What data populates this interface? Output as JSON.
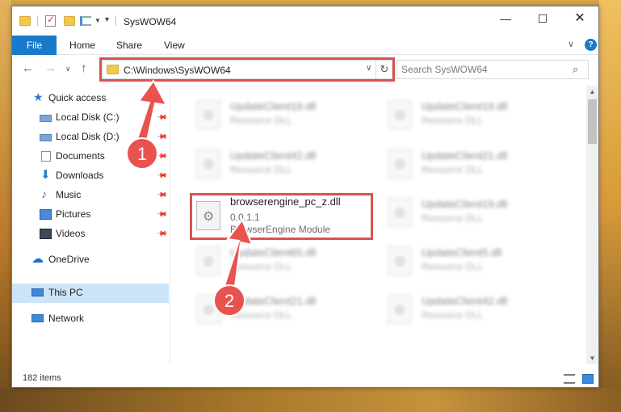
{
  "window": {
    "title": "SysWOW64"
  },
  "ribbon": {
    "tabs": [
      "File",
      "Home",
      "Share",
      "View"
    ]
  },
  "navigation": {
    "address": "C:\\Windows\\SysWOW64",
    "search_placeholder": "Search SysWOW64"
  },
  "sidebar": {
    "items": [
      {
        "label": "Quick access",
        "icon": "star-icon",
        "pinned": false
      },
      {
        "label": "Local Disk (C:)",
        "icon": "drive-icon",
        "pinned": true
      },
      {
        "label": "Local Disk (D:)",
        "icon": "drive-icon",
        "pinned": true
      },
      {
        "label": "Documents",
        "icon": "documents-icon",
        "pinned": true
      },
      {
        "label": "Downloads",
        "icon": "download-icon",
        "pinned": true
      },
      {
        "label": "Music",
        "icon": "music-icon",
        "pinned": true
      },
      {
        "label": "Pictures",
        "icon": "pictures-icon",
        "pinned": true
      },
      {
        "label": "Videos",
        "icon": "videos-icon",
        "pinned": true
      },
      {
        "label": "OneDrive",
        "icon": "cloud-icon",
        "pinned": false
      },
      {
        "label": "This PC",
        "icon": "computer-icon",
        "pinned": false,
        "selected": true
      },
      {
        "label": "Network",
        "icon": "network-icon",
        "pinned": false
      }
    ]
  },
  "files": [
    {
      "name": "UpdateClient19.dll",
      "sub": "Resource DLL",
      "blurred": true
    },
    {
      "name": "UpdateClient19.dll",
      "sub": "Resource DLL",
      "blurred": true
    },
    {
      "name": "UpdateClient42.dll",
      "sub": "Resource DLL",
      "blurred": true
    },
    {
      "name": "UpdateClient21.dll",
      "sub": "Resource DLL",
      "blurred": true
    },
    {
      "name": "browserengine_pc_z.dll",
      "version": "0.0.1.1",
      "description": "BrowserEngine Module",
      "blurred": false
    },
    {
      "name": "UpdateClient19.dll",
      "sub": "Resource DLL",
      "blurred": true
    },
    {
      "name": "UpdateClient65.dll",
      "sub": "Resource DLL",
      "blurred": true
    },
    {
      "name": "UpdateClient5.dll",
      "sub": "Resource DLL",
      "blurred": true
    },
    {
      "name": "UpdateClient21.dll",
      "sub": "Resource DLL",
      "blurred": true
    },
    {
      "name": "UpdateClient42.dll",
      "sub": "Resource DLL",
      "blurred": true
    }
  ],
  "status": {
    "item_count": "182 items"
  },
  "annotations": {
    "step1": "1",
    "step2": "2"
  },
  "colors": {
    "accent": "#1979ca",
    "highlight": "#d9534f",
    "selected_bg": "#cce4f7"
  }
}
